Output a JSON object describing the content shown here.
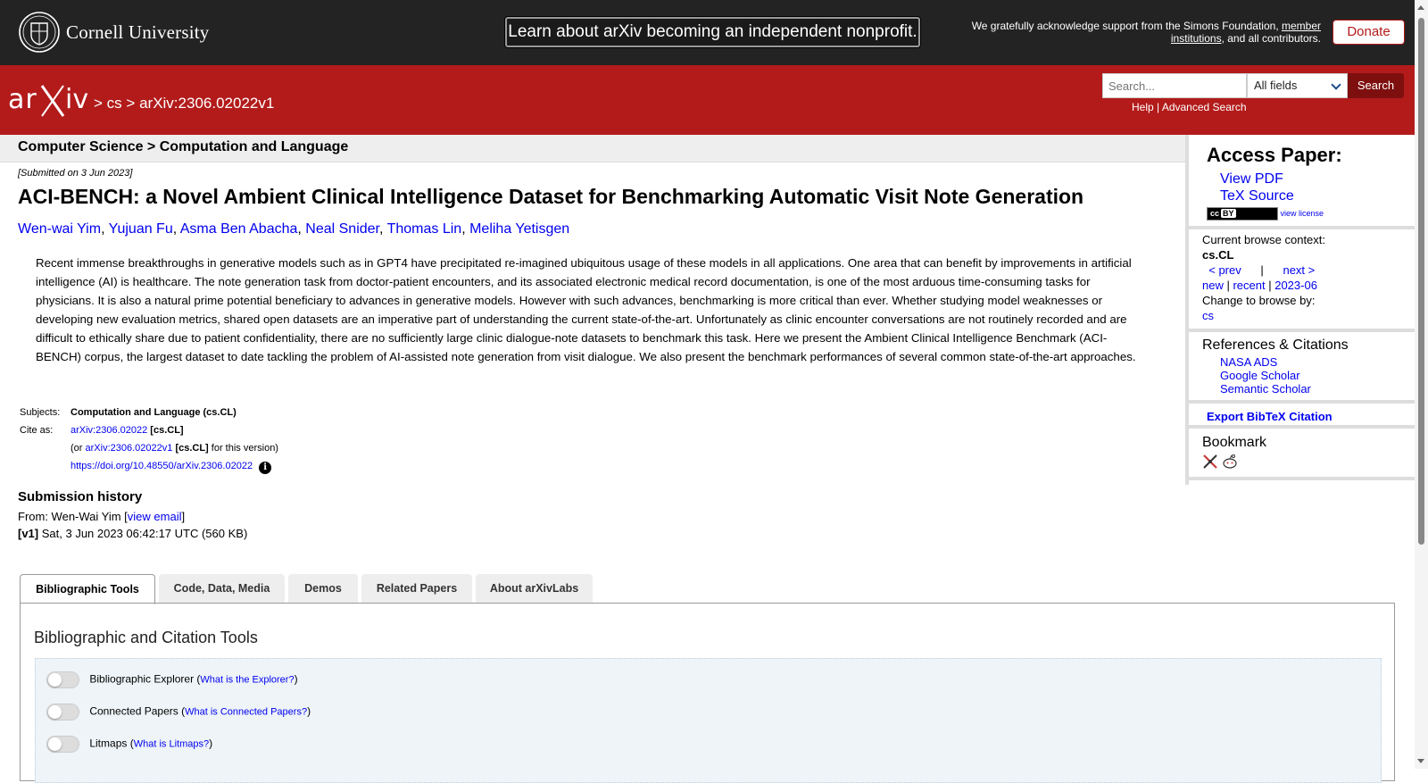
{
  "topbar": {
    "cornell_name": "Cornell University",
    "banner": "Learn about arXiv becoming an independent nonprofit.",
    "support_prefix": "We gratefully acknowledge support from the Simons Foundation, ",
    "support_link": "member institutions",
    "support_suffix": ", and all contributors.",
    "donate": "Donate"
  },
  "header": {
    "logo_text": "arXiv",
    "crumb_sep1": ">",
    "crumb_cs": "cs",
    "crumb_sep2": ">",
    "crumb_id": "arXiv:2306.02022v1",
    "search_placeholder": "Search...",
    "search_field": "All fields",
    "search_button": "Search",
    "help": "Help",
    "help_sep": "|",
    "advanced": "Advanced Search"
  },
  "subheader": "Computer Science > Computation and Language",
  "paper": {
    "submitted": "[Submitted on 3 Jun 2023]",
    "title": "ACI-BENCH: a Novel Ambient Clinical Intelligence Dataset for Benchmarking Automatic Visit Note Generation",
    "authors": [
      "Wen-wai Yim",
      "Yujuan Fu",
      "Asma Ben Abacha",
      "Neal Snider",
      "Thomas Lin",
      "Meliha Yetisgen"
    ],
    "abstract": "Recent immense breakthroughs in generative models such as in GPT4 have precipitated re-imagined ubiquitous usage of these models in all applications. One area that can benefit by improvements in artificial intelligence (AI) is healthcare. The note generation task from doctor-patient encounters, and its associated electronic medical record documentation, is one of the most arduous time-consuming tasks for physicians. It is also a natural prime potential beneficiary to advances in generative models. However with such advances, benchmarking is more critical than ever. Whether studying model weaknesses or developing new evaluation metrics, shared open datasets are an imperative part of understanding the current state-of-the-art. Unfortunately as clinic encounter conversations are not routinely recorded and are difficult to ethically share due to patient confidentiality, there are no sufficiently large clinic dialogue-note datasets to benchmark this task. Here we present the Ambient Clinical Intelligence Benchmark (ACI-BENCH) corpus, the largest dataset to date tackling the problem of AI-assisted note generation from visit dialogue. We also present the benchmark performances of several common state-of-the-art approaches."
  },
  "meta": {
    "subjects_label": "Subjects:",
    "subjects": "Computation and Language (cs.CL)",
    "cite_label": "Cite as:",
    "cite_id": "arXiv:2306.02022",
    "cite_cat": "[cs.CL]",
    "cite_or": "(or",
    "cite_version_id": "arXiv:2306.02022v1",
    "cite_version_cat": "[cs.CL]",
    "cite_version_suffix": "for this version)",
    "doi": "https://doi.org/10.48550/arXiv.2306.02022",
    "info_icon": "i"
  },
  "history": {
    "title": "Submission history",
    "from_label": "From: Wen-Wai Yim [",
    "view_email": "view email",
    "from_close": "]",
    "v1_label": "[v1]",
    "v1_text": "Sat, 3 Jun 2023 06:42:17 UTC (560 KB)"
  },
  "sidebar": {
    "access_title": "Access Paper:",
    "view_pdf": "View PDF",
    "tex_source": "TeX Source",
    "cc_badge": "BY",
    "view_license": "view license",
    "browse_label": "Current browse context:",
    "browse_ctx": "cs.CL",
    "prev": "< prev",
    "nav_sep": "|",
    "next": "next >",
    "new": "new",
    "recent": "recent",
    "month": "2023-06",
    "change_label": "Change to browse by:",
    "change_cs": "cs",
    "refs_title": "References & Citations",
    "refs": [
      "NASA ADS",
      "Google Scholar",
      "Semantic Scholar"
    ],
    "bibtex": "Export BibTeX Citation",
    "bookmark_title": "Bookmark"
  },
  "tabs": [
    "Bibliographic Tools",
    "Code, Data, Media",
    "Demos",
    "Related Papers",
    "About arXivLabs"
  ],
  "tools": {
    "panel_title": "Bibliographic and Citation Tools",
    "rows": [
      {
        "label": "Bibliographic Explorer",
        "link": "What is the Explorer?"
      },
      {
        "label": "Connected Papers",
        "link": "What is Connected Papers?"
      },
      {
        "label": "Litmaps",
        "link": "What is Litmaps?"
      }
    ]
  },
  "colors": {
    "arxiv_red": "#b31b1b",
    "topbar_bg": "#232323",
    "link": "#0000ee"
  }
}
